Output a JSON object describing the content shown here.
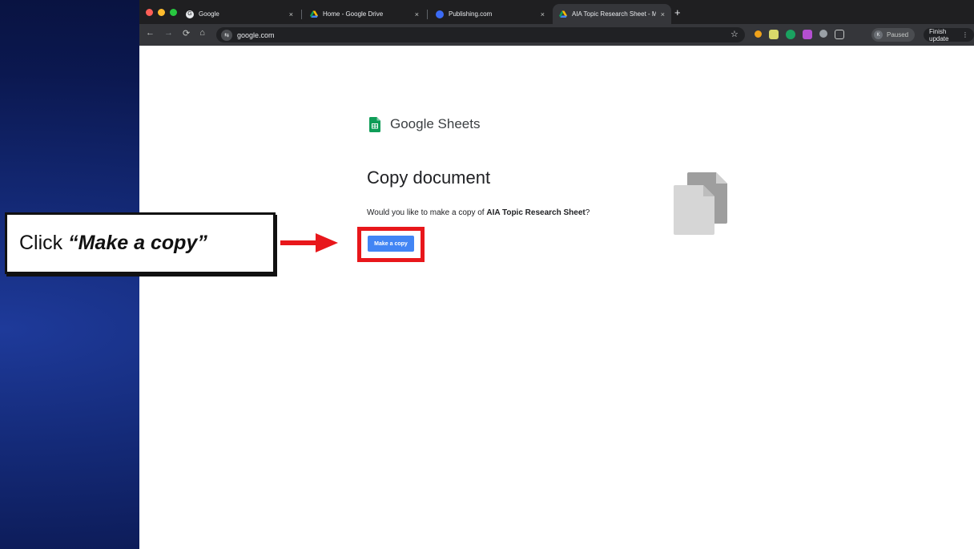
{
  "browser": {
    "tabs": [
      {
        "title": "Google",
        "active": false
      },
      {
        "title": "Home - Google Drive",
        "active": false
      },
      {
        "title": "Publishing.com",
        "active": false
      },
      {
        "title": "AIA Topic Research Sheet - M",
        "active": true
      }
    ],
    "new_tab": "+",
    "close_glyph": "×",
    "url": "google.com",
    "profile_initial": "K",
    "profile_status": "Paused",
    "finish_update": "Finish update"
  },
  "page": {
    "brand": "Google Sheets",
    "heading": "Copy document",
    "question_prefix": "Would you like to make a copy of ",
    "document_name": "AIA Topic Research Sheet",
    "question_suffix": "?",
    "make_copy_label": "Make a copy"
  },
  "annotation": {
    "prefix": "Click",
    "emphasis": "“Make a copy”"
  },
  "colors": {
    "accent_blue": "#4285f4",
    "highlight_red": "#e8171b",
    "sheets_green": "#0f9d58"
  },
  "icons": {
    "back": "arrow-left-icon",
    "forward": "arrow-right-icon",
    "reload": "reload-icon",
    "home": "home-icon",
    "bookmark": "star-icon",
    "document": "document-copy-icon"
  }
}
